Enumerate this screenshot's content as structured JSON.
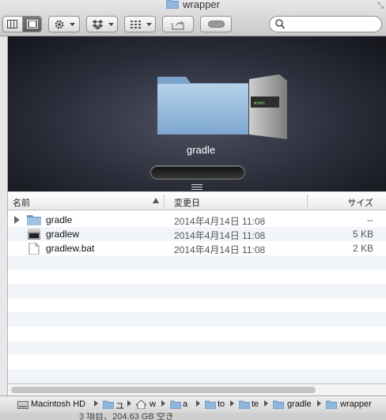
{
  "window": {
    "title": "wrapper",
    "title_icon": "folder-icon",
    "colors": {
      "folder_blue": "#8fb6dc",
      "selection": "#3875d7",
      "stripe": "#f1f5fa"
    }
  },
  "toolbar": {
    "view_buttons": [
      "list-view-icon",
      "coverflow-view-icon"
    ],
    "action_menu_icon": "gear-icon",
    "dropbox_menu_icon": "dropbox-icon",
    "arrange_menu_icon": "arrange-grid-icon",
    "share_icon": "share-icon",
    "tags_icon": "tag-toggle-icon",
    "search": {
      "placeholder": "",
      "value": ""
    }
  },
  "preview": {
    "folder_name": "gradle"
  },
  "columns": {
    "name": "名前",
    "date": "変更日",
    "size": "サイズ"
  },
  "files": [
    {
      "name": "gradle",
      "date": "2014年4月14日 11:08",
      "size": "--",
      "kind": "folder"
    },
    {
      "name": "gradlew",
      "date": "2014年4月14日 11:08",
      "size": "5 KB",
      "kind": "exec"
    },
    {
      "name": "gradlew.bat",
      "date": "2014年4月14日 11:08",
      "size": "2 KB",
      "kind": "doc"
    }
  ],
  "pathbar": {
    "items": [
      "Macintosh HD",
      "ユ",
      "w",
      "a",
      "to",
      "te",
      "gradle",
      "wrapper"
    ]
  },
  "status": {
    "text": "3 項目、204.63 GB 空き"
  }
}
